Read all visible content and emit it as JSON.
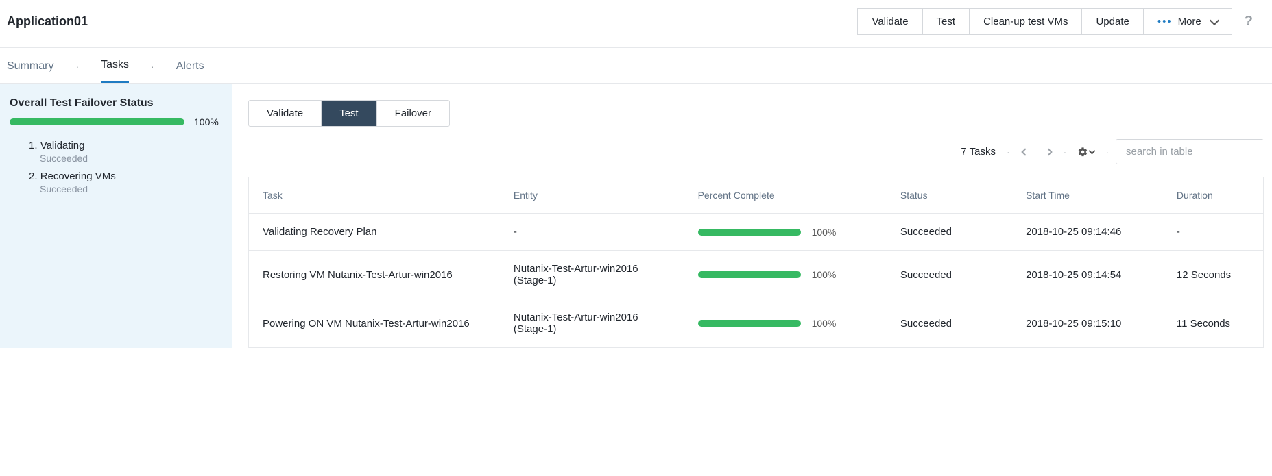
{
  "header": {
    "title": "Application01",
    "actions": {
      "validate": "Validate",
      "test": "Test",
      "cleanup": "Clean-up test VMs",
      "update": "Update",
      "more": "More"
    }
  },
  "tabs": {
    "summary": "Summary",
    "tasks": "Tasks",
    "alerts": "Alerts",
    "active": "tasks"
  },
  "sidebar": {
    "title": "Overall Test Failover Status",
    "progress_pct": 100,
    "progress_label": "100%",
    "steps": [
      {
        "idx": "1.",
        "label": "Validating",
        "status": "Succeeded"
      },
      {
        "idx": "2.",
        "label": "Recovering VMs",
        "status": "Succeeded"
      }
    ]
  },
  "main": {
    "segmented": {
      "validate": "Validate",
      "test": "Test",
      "failover": "Failover",
      "active": "test"
    },
    "controls": {
      "task_count": "7 Tasks",
      "search_placeholder": "search in table"
    },
    "columns": {
      "task": "Task",
      "entity": "Entity",
      "pct": "Percent Complete",
      "status": "Status",
      "start": "Start Time",
      "duration": "Duration"
    },
    "rows": [
      {
        "task": "Validating Recovery Plan",
        "entity": "-",
        "pct_label": "100%",
        "status": "Succeeded",
        "start": "2018-10-25 09:14:46",
        "duration": "-"
      },
      {
        "task": "Restoring VM Nutanix-Test-Artur-win2016",
        "entity": "Nutanix-Test-Artur-win2016 (Stage-1)",
        "pct_label": "100%",
        "status": "Succeeded",
        "start": "2018-10-25 09:14:54",
        "duration": "12 Seconds"
      },
      {
        "task": "Powering ON VM Nutanix-Test-Artur-win2016",
        "entity": "Nutanix-Test-Artur-win2016 (Stage-1)",
        "pct_label": "100%",
        "status": "Succeeded",
        "start": "2018-10-25 09:15:10",
        "duration": "11 Seconds"
      }
    ]
  }
}
